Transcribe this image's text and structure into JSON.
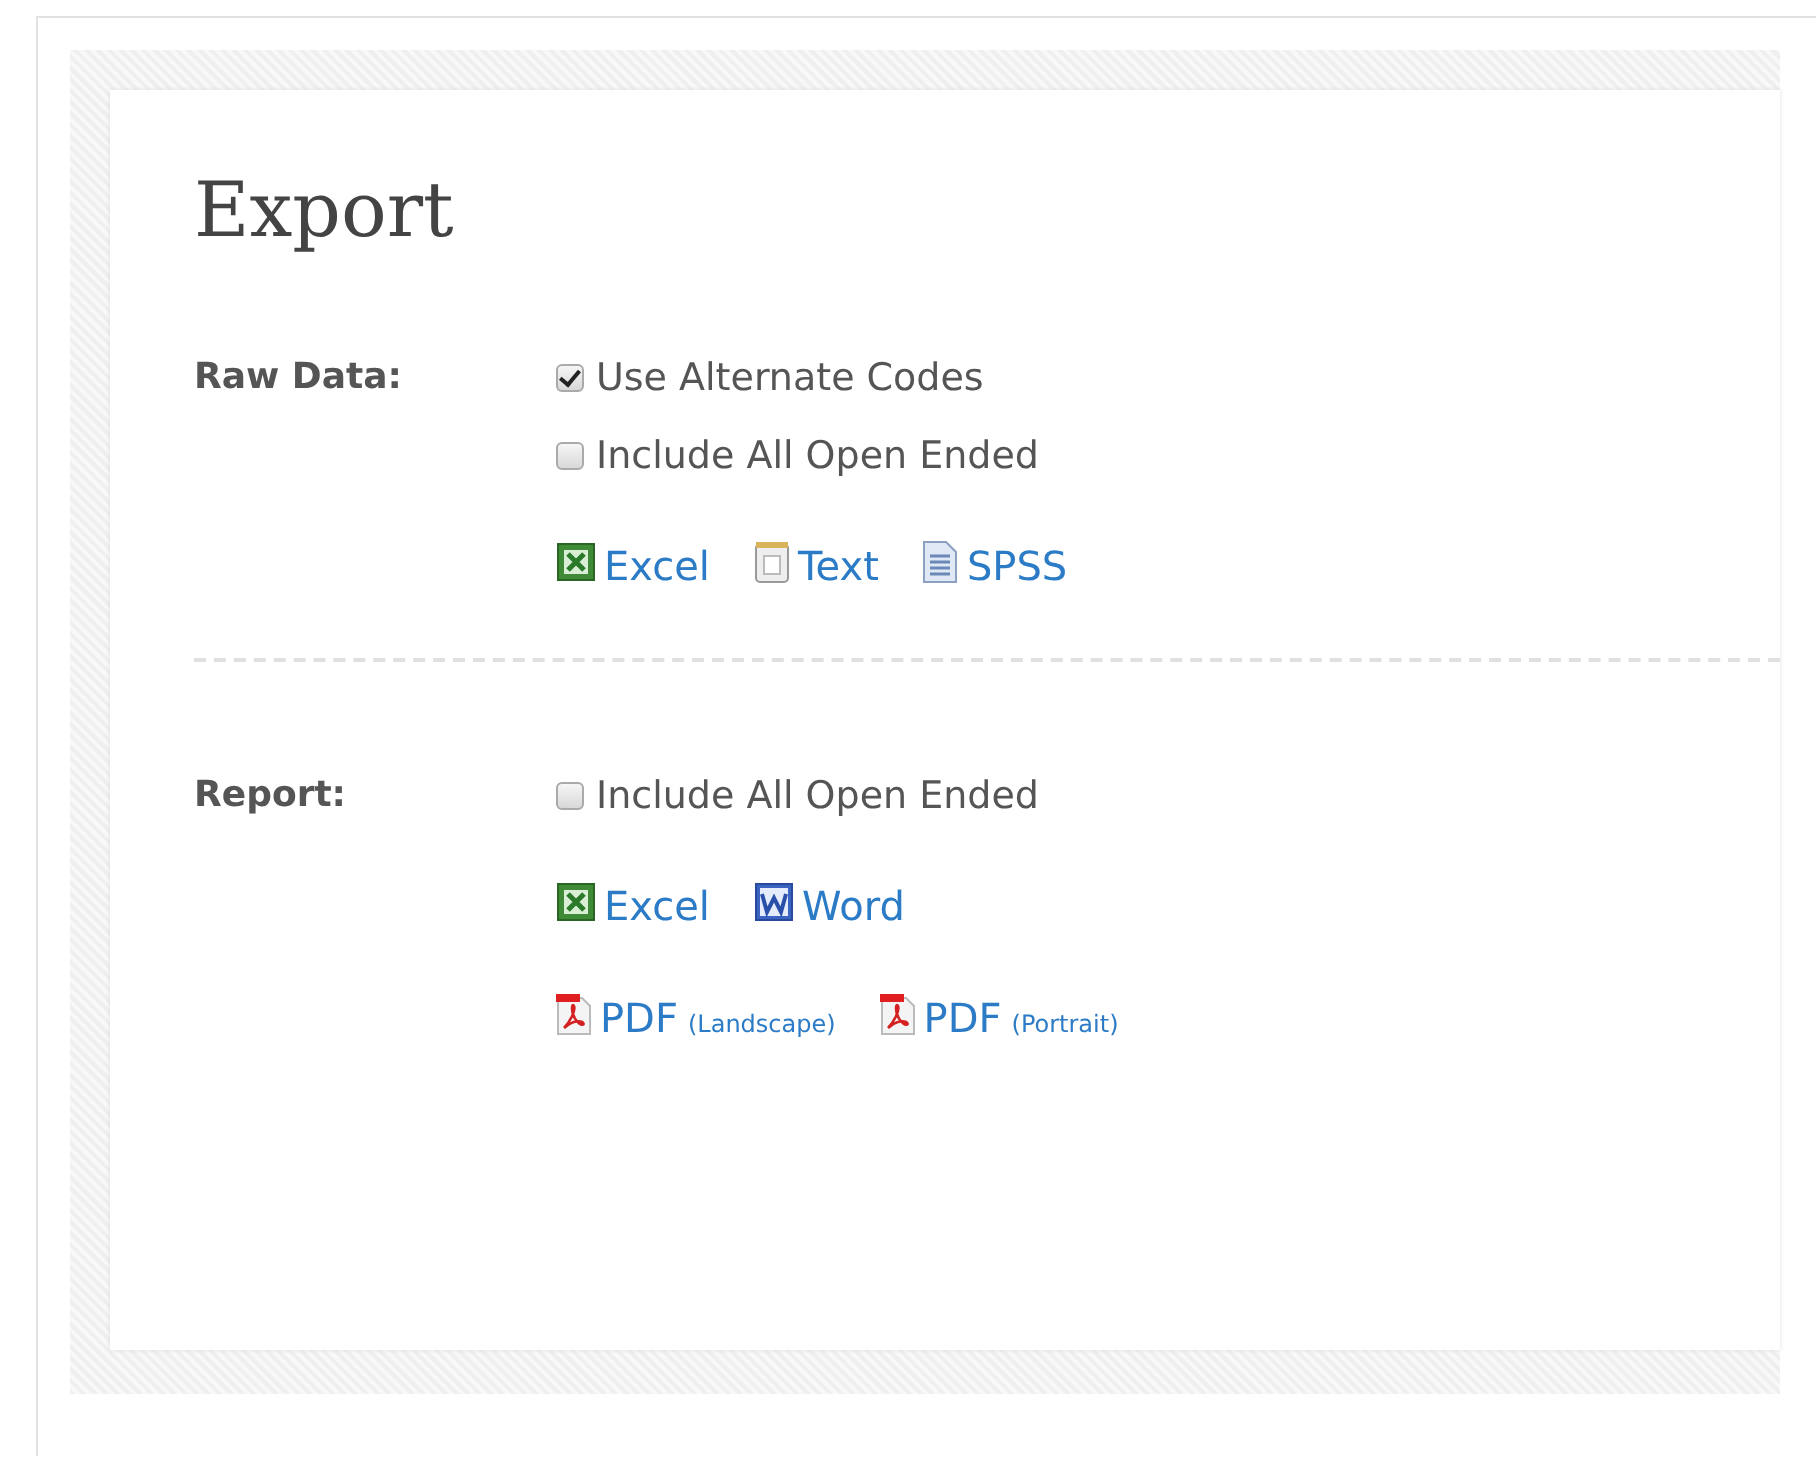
{
  "title": "Export",
  "sections": [
    {
      "label": "Raw Data:",
      "options": [
        {
          "label": "Use Alternate Codes",
          "checked": true
        },
        {
          "label": "Include All Open Ended",
          "checked": false
        }
      ],
      "link_rows": [
        [
          {
            "kind": "excel",
            "label": "Excel"
          },
          {
            "kind": "text",
            "label": "Text"
          },
          {
            "kind": "spss",
            "label": "SPSS"
          }
        ]
      ]
    },
    {
      "label": "Report:",
      "options": [
        {
          "label": "Include All Open Ended",
          "checked": false
        }
      ],
      "link_rows": [
        [
          {
            "kind": "excel",
            "label": "Excel"
          },
          {
            "kind": "word",
            "label": "Word"
          }
        ],
        [
          {
            "kind": "pdf",
            "label": "PDF",
            "note": "(Landscape)"
          },
          {
            "kind": "pdf",
            "label": "PDF",
            "note": "(Portrait)"
          }
        ]
      ]
    }
  ]
}
